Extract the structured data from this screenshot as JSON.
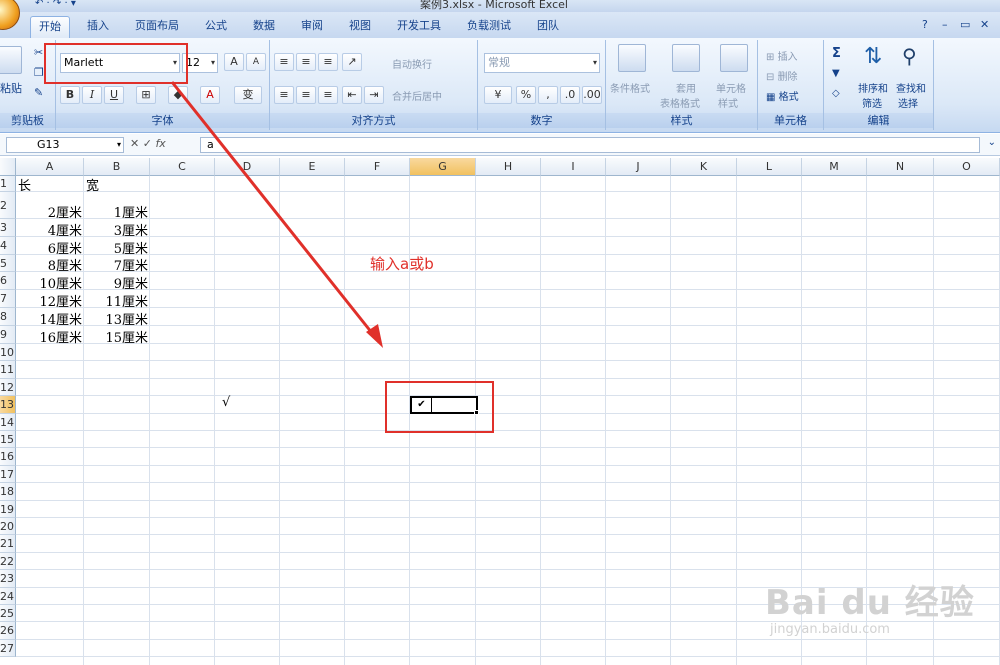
{
  "window": {
    "title": "案例3.xlsx - Microsoft Excel",
    "controls": [
      "?",
      "–",
      "▭",
      "✕"
    ]
  },
  "tabs": [
    "开始",
    "插入",
    "页面布局",
    "公式",
    "数据",
    "审阅",
    "视图",
    "开发工具",
    "负载测试",
    "团队"
  ],
  "ribbon": {
    "clipboard": {
      "paste_label": "粘贴",
      "group_label": "剪贴板"
    },
    "font": {
      "font_name": "Marlett",
      "font_size": "12",
      "bold": "B",
      "italic": "I",
      "underline": "U",
      "group_label": "字体"
    },
    "alignment": {
      "wrap_text": "自动换行",
      "merge_center": "合并后居中",
      "group_label": "对齐方式"
    },
    "number": {
      "format": "常规",
      "percent": "%",
      "group_label": "数字"
    },
    "styles": {
      "conditional": "条件格式",
      "table_fmt_1": "套用",
      "table_fmt_2": "表格格式",
      "cell_styles_1": "单元格",
      "cell_styles_2": "样式",
      "group_label": "样式"
    },
    "cells": {
      "insert": "插入",
      "delete": "删除",
      "format": "格式",
      "group_label": "单元格"
    },
    "editing": {
      "sigma": "Σ",
      "sort_1": "排序和",
      "sort_2": "筛选",
      "find_1": "查找和",
      "find_2": "选择",
      "group_label": "编辑"
    }
  },
  "formula_bar": {
    "name_box": "G13",
    "fx": "fx",
    "content": "a"
  },
  "grid": {
    "columns": [
      "A",
      "B",
      "C",
      "D",
      "E",
      "F",
      "G",
      "H",
      "I",
      "J",
      "K",
      "L",
      "M",
      "N",
      "O"
    ],
    "rows": [
      "1",
      "2",
      "3",
      "4",
      "5",
      "6",
      "7",
      "8",
      "9",
      "10",
      "11",
      "12",
      "13",
      "14",
      "15",
      "16",
      "17",
      "18",
      "19",
      "20",
      "21",
      "22",
      "23",
      "24",
      "25",
      "26",
      "27"
    ],
    "col_a_values": [
      "长",
      "2厘米",
      "4厘米",
      "6厘米",
      "8厘米",
      "10厘米",
      "12厘米",
      "14厘米",
      "16厘米"
    ],
    "col_b_values": [
      "宽",
      "1厘米",
      "3厘米",
      "5厘米",
      "7厘米",
      "9厘米",
      "11厘米",
      "13厘米",
      "15厘米"
    ],
    "d13_value": "√",
    "g13_value": "✔"
  },
  "annotation_text": "输入a或b",
  "watermark": {
    "brand": "Bai du 经验",
    "url": "jingyan.baidu.com"
  },
  "colors": {
    "annotation": "#e0302a",
    "ribbon": "#dbe8f7",
    "selected_header": "#f1c15f"
  }
}
